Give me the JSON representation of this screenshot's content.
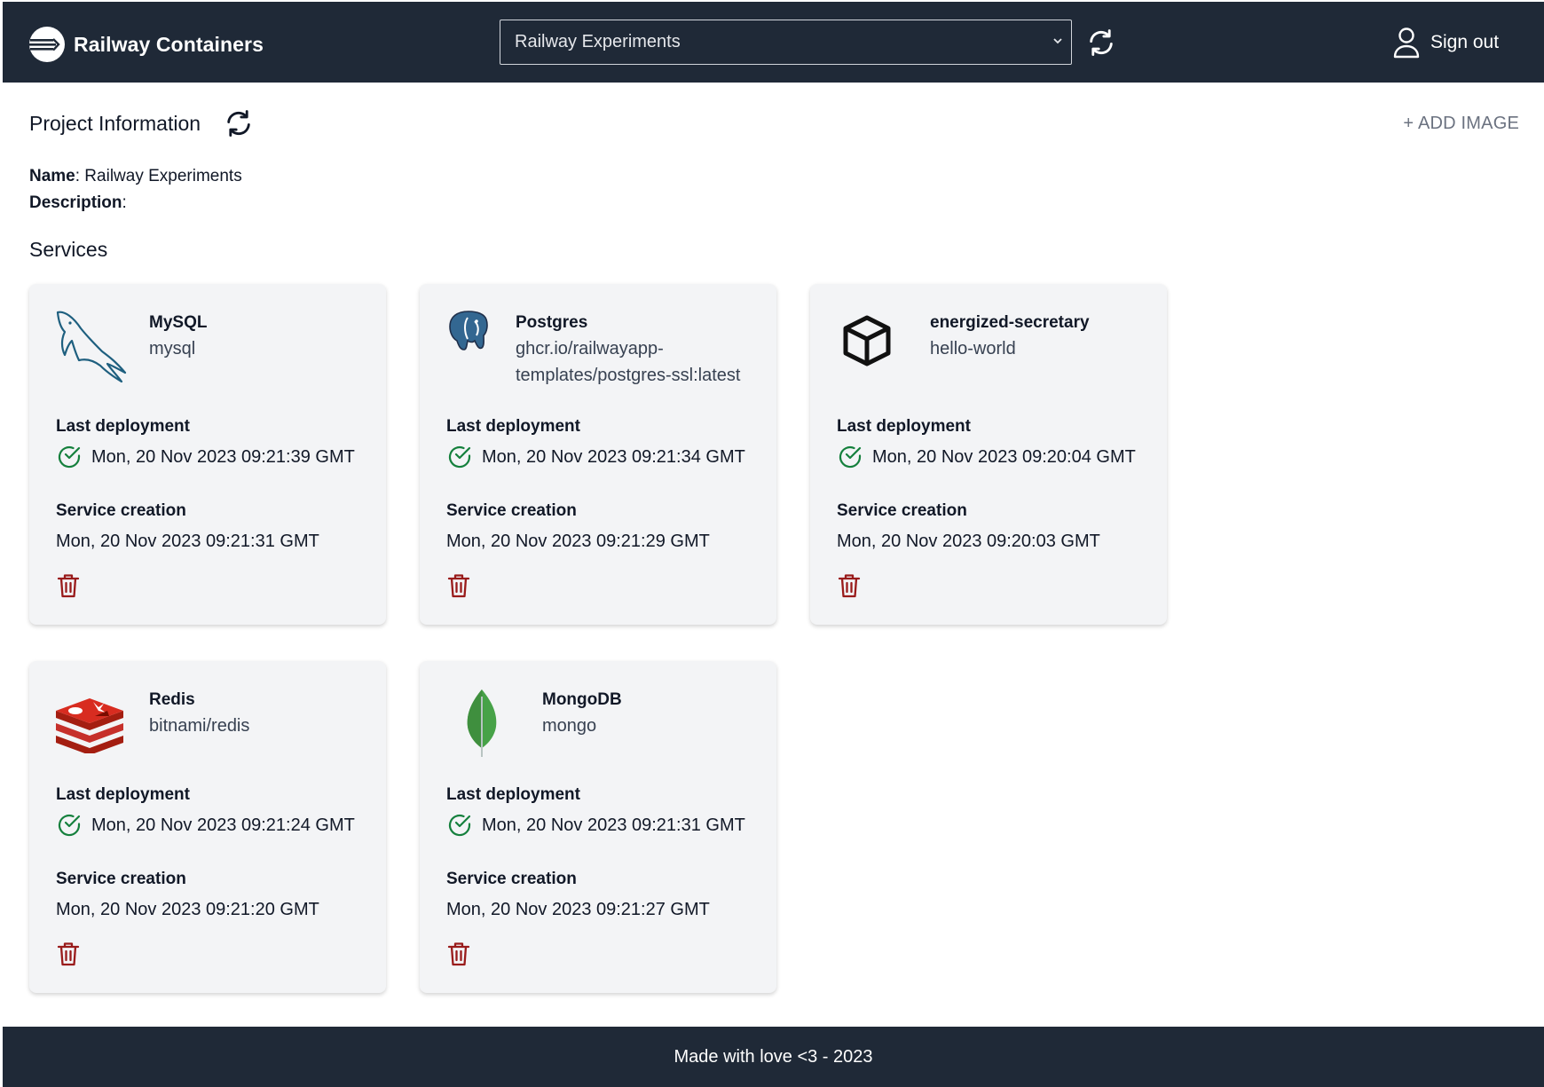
{
  "header": {
    "app_name": "Railway Containers",
    "project_select_value": "Railway Experiments",
    "signout_label": "Sign out"
  },
  "project": {
    "section_title": "Project Information",
    "add_image_label": "+ ADD IMAGE",
    "name_label": "Name",
    "name_value": ": Railway Experiments",
    "description_label": "Description",
    "description_value": ":"
  },
  "services": {
    "section_title": "Services",
    "last_deployment_label": "Last deployment",
    "service_creation_label": "Service creation",
    "items": [
      {
        "name": "MySQL",
        "image_line1": "mysql",
        "image_line2": "",
        "icon": "mysql-dolphin-icon",
        "last_deployment": "Mon, 20 Nov 2023 09:21:39 GMT",
        "created": "Mon, 20 Nov 2023 09:21:31 GMT"
      },
      {
        "name": "Postgres",
        "image_line1": "ghcr.io/railwayapp-",
        "image_line2": "templates/postgres-ssl:latest",
        "icon": "postgres-elephant-icon",
        "last_deployment": "Mon, 20 Nov 2023 09:21:34 GMT",
        "created": "Mon, 20 Nov 2023 09:21:29 GMT"
      },
      {
        "name": "energized-secretary",
        "image_line1": "hello-world",
        "image_line2": "",
        "icon": "cube-icon",
        "last_deployment": "Mon, 20 Nov 2023 09:20:04 GMT",
        "created": "Mon, 20 Nov 2023 09:20:03 GMT"
      },
      {
        "name": "Redis",
        "image_line1": "bitnami/redis",
        "image_line2": "",
        "icon": "redis-stack-icon",
        "last_deployment": "Mon, 20 Nov 2023 09:21:24 GMT",
        "created": "Mon, 20 Nov 2023 09:21:20 GMT"
      },
      {
        "name": "MongoDB",
        "image_line1": "mongo",
        "image_line2": "",
        "icon": "mongodb-leaf-icon",
        "last_deployment": "Mon, 20 Nov 2023 09:21:31 GMT",
        "created": "Mon, 20 Nov 2023 09:21:27 GMT"
      }
    ]
  },
  "footer": {
    "text": "Made with love <3 - 2023"
  },
  "colors": {
    "header_bg": "#1f2937",
    "card_bg": "#f3f4f6",
    "success": "#15803d",
    "danger": "#991b1b"
  }
}
